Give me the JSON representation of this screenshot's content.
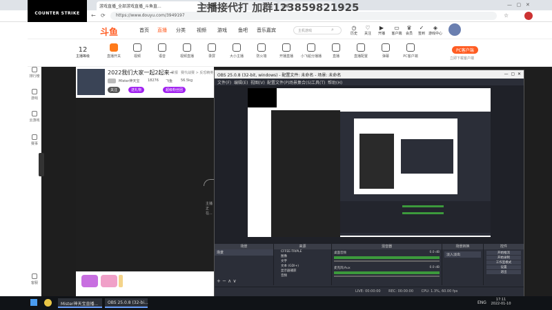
{
  "browser": {
    "tabs": [
      {
        "label": "游戏直播_全部游戏直播_斗鱼直..."
      },
      {
        "label": "斗鱼直..."
      },
      {
        "label": "斗鱼"
      }
    ],
    "url": "https://www.douyu.com/3949197"
  },
  "streamlogo": {
    "text": "COUNTER STRIKE"
  },
  "watermark": {
    "text": "主播接代打 加群123859821925"
  },
  "nav": {
    "logo": "斗鱼",
    "items": [
      "首页",
      "直播",
      "分类",
      "视频",
      "游戏",
      "鱼吧",
      "音乐嘉宾"
    ],
    "search_placeholder": "主机游戏",
    "right": [
      "历史",
      "关注",
      "开播",
      "客户端",
      "会员",
      "签到",
      "游戏中心"
    ]
  },
  "cats": {
    "count": "12",
    "count_label": "主播等级",
    "items": [
      "直播开关",
      "视频",
      "语音",
      "视频直播",
      "录屏",
      "大小主播",
      "防火墙",
      "开播直播",
      "小飞船分播播",
      "直播",
      "直播配置",
      "弹幕",
      "PC客户端"
    ],
    "pc_label": "PC客户端",
    "download_label": "立即下载客户端"
  },
  "rail": {
    "items": [
      "关注",
      "排行榜",
      "游戏",
      "云游戏",
      "赛事",
      "客服"
    ]
  },
  "room": {
    "title": "2022我们大家一起2起来~",
    "tags": [
      "举报",
      "赛代战赛 > 反恐精英"
    ],
    "streamer": "Mister神天宝",
    "followers": "18276",
    "heat": "飞鱼",
    "viewers": "56.5kg",
    "follow_btn": "关注",
    "btn1": "送礼物",
    "btn2": "超级粉丝团"
  },
  "video": {
    "overlay": "主播正在..."
  },
  "obs": {
    "title": "OBS 25.0.8 (32-bit, windows) - 配置文件: 未命名 - 场景: 未命名",
    "menu": [
      "文件(F)",
      "编辑(E)",
      "视图(V)",
      "配置文件(P)",
      "场景集合(S)",
      "工具(T)",
      "帮助(H)"
    ],
    "dock_headers": [
      "场景",
      "来源",
      "混音器",
      "场景转换",
      "控件"
    ],
    "scene": "场景",
    "sources": [
      "CFFEE-TRIPLE",
      "图像",
      "文字",
      "文本 (GDI+)",
      "显示器捕获",
      "音频"
    ],
    "mixer": [
      {
        "label": "桌面音频",
        "db": "0.0 dB"
      },
      {
        "label": "麦克风/Aux",
        "db": "0.0 dB"
      }
    ],
    "transition": "淡入淡出",
    "controls": [
      "开始推流",
      "开始录制",
      "工作室模式",
      "设置",
      "退出"
    ],
    "status": {
      "live": "LIVE: 00:00:00",
      "rec": "REC: 00:00:00",
      "cpu": "CPU: 1.3%, 60.00 fps"
    }
  },
  "taskbar": {
    "items": [
      "Mister神天宝直播...",
      "OBS 25.0.8 (32-bi..."
    ],
    "lang": "ENG",
    "time": "17:11",
    "date": "2022-01-10"
  }
}
